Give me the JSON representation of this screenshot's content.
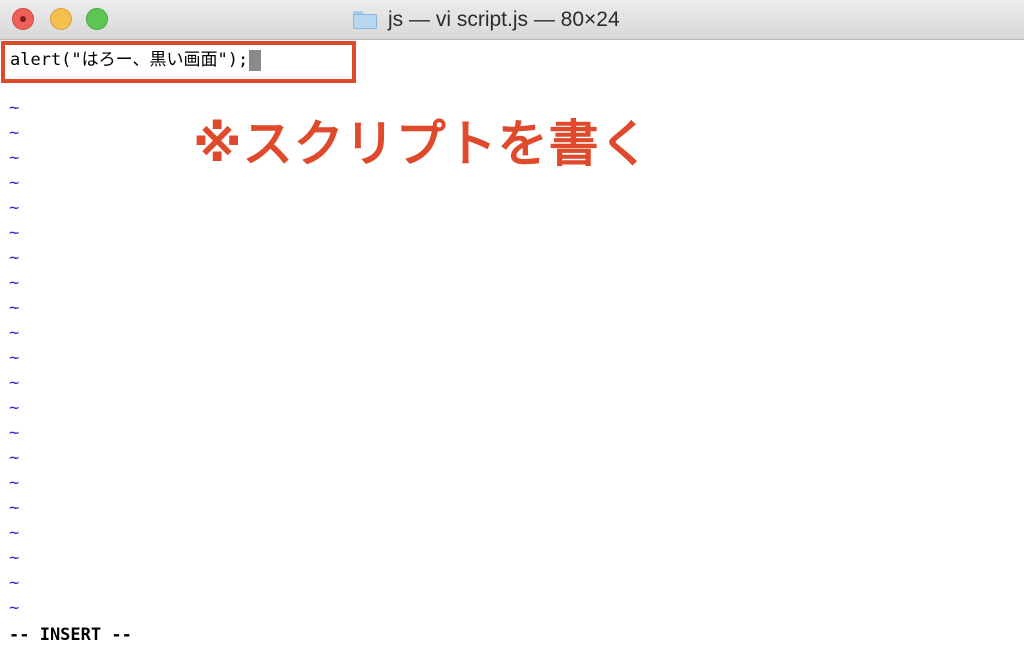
{
  "window": {
    "title": "js — vi script.js — 80×24"
  },
  "editor": {
    "code": "alert(\"はろー、黒い画面\");",
    "tilde": "~",
    "mode": "-- INSERT --"
  },
  "annotation": {
    "text": "※スクリプトを書く",
    "color": "#e04a2c"
  },
  "colors": {
    "close": "#ed5f57",
    "minimize": "#f5be4f",
    "maximize": "#5ec454",
    "tilde": "#2b2bd0"
  },
  "icons": {
    "title": "folder-icon"
  }
}
